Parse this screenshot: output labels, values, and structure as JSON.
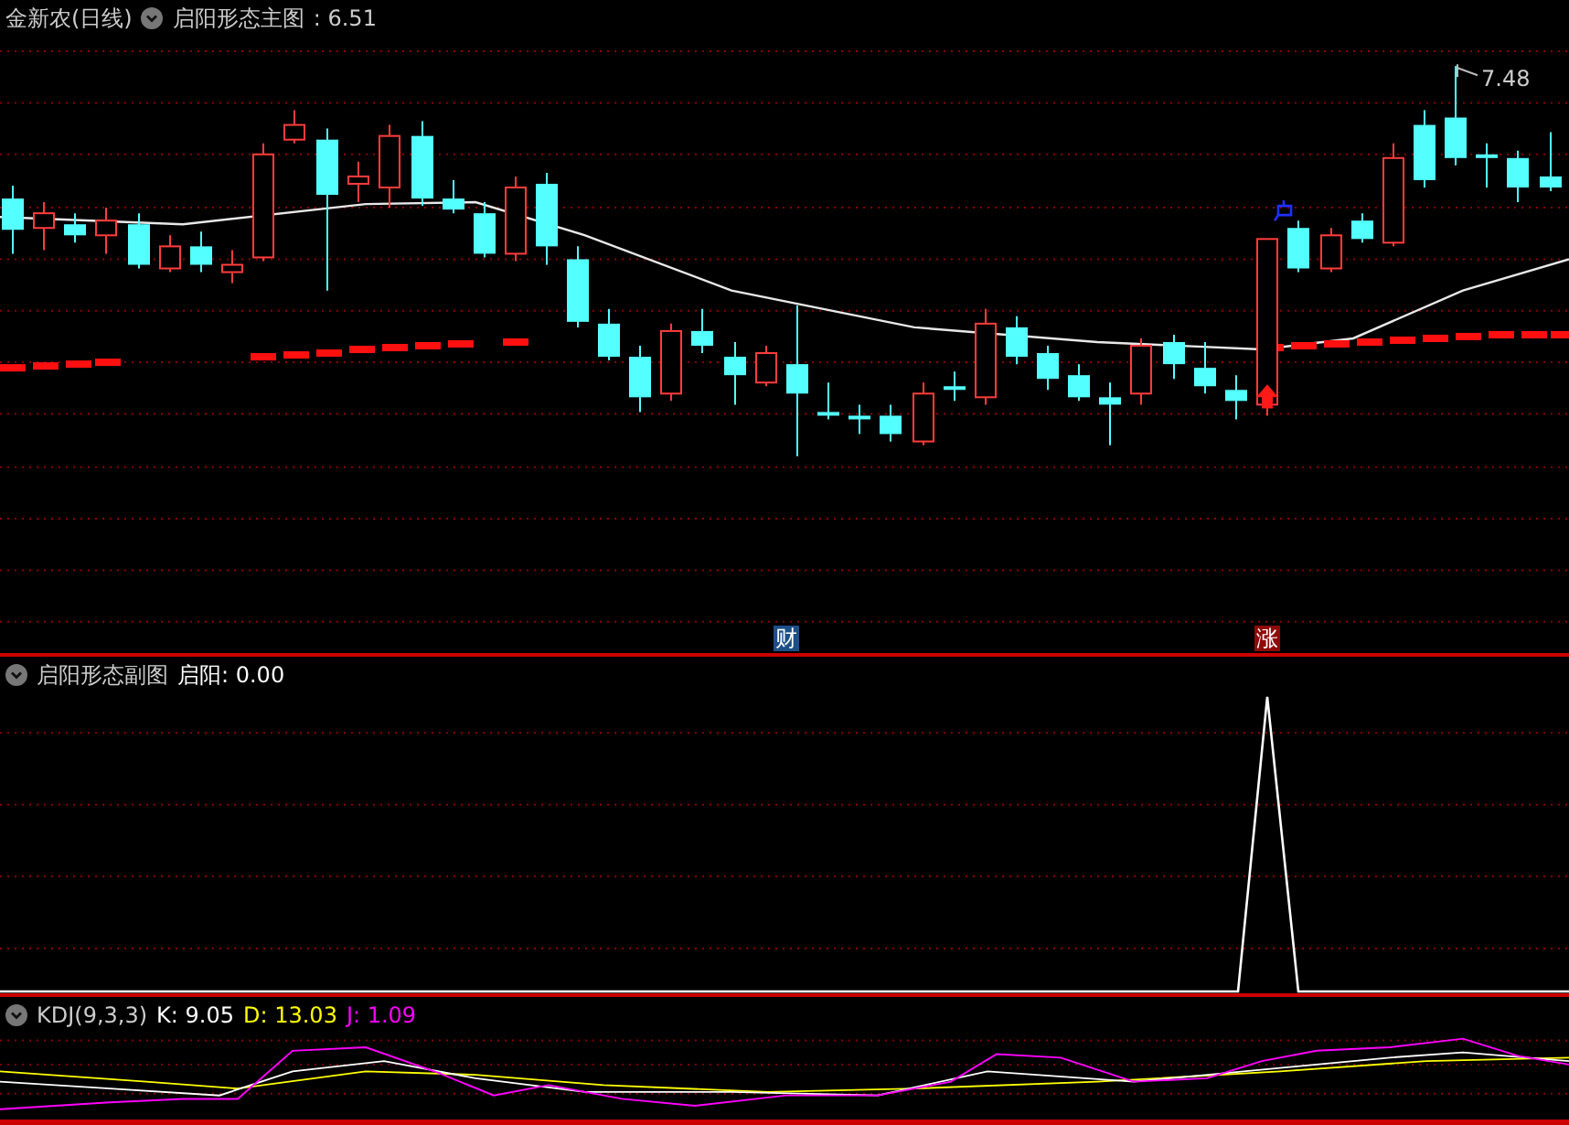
{
  "main_panel": {
    "stock": "金新农(日线)",
    "indicator": "启阳形态主图",
    "value": ": 6.51",
    "high_label": "7.48",
    "markers": [
      {
        "text": "财",
        "color": "#1c4f86"
      },
      {
        "text": "涨",
        "color": "#8e0a0a"
      }
    ]
  },
  "sub_panel": {
    "indicator": "启阳形态副图",
    "reading_label": "启阳:",
    "value": "0.00"
  },
  "kdj_panel": {
    "indicator": "KDJ(9,3,3)",
    "readings": [
      {
        "label": "K:",
        "value": "9.05",
        "color": "#ffffff"
      },
      {
        "label": "D:",
        "value": "13.03",
        "color": "#ffff00"
      },
      {
        "label": "J:",
        "value": "1.09",
        "color": "#ff00ff"
      }
    ]
  }
}
